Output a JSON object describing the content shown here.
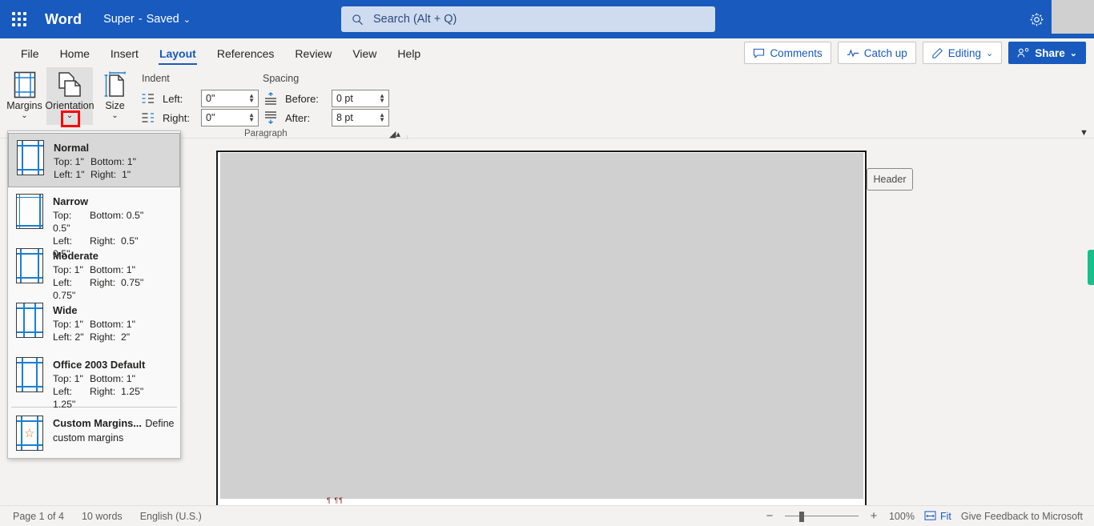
{
  "titlebar": {
    "app_grid_icon": "waffle-icon",
    "app_name": "Word",
    "doc_name": "Super",
    "doc_separator": "-",
    "save_state": "Saved",
    "doc_chevron": "⌄",
    "search_icon": "search-icon",
    "search_placeholder": "Search (Alt + Q)",
    "settings_icon": "gear-icon",
    "brand_color": "#185abd"
  },
  "tabs": [
    {
      "label": "File",
      "active": false
    },
    {
      "label": "Home",
      "active": false
    },
    {
      "label": "Insert",
      "active": false
    },
    {
      "label": "Layout",
      "active": true
    },
    {
      "label": "References",
      "active": false
    },
    {
      "label": "Review",
      "active": false
    },
    {
      "label": "View",
      "active": false
    },
    {
      "label": "Help",
      "active": false
    }
  ],
  "tabbar_buttons": [
    {
      "label": "Comments",
      "icon": "comment-icon"
    },
    {
      "label": "Catch up",
      "icon": "activity-icon"
    },
    {
      "label": "Editing",
      "icon": "pencil-icon",
      "chevron": "⌄"
    },
    {
      "label": "Share",
      "icon": "share-person-icon",
      "chevron": "⌄",
      "primary": true
    }
  ],
  "ribbon": {
    "big_buttons": [
      {
        "label": "Margins",
        "icon": "margins-icon",
        "chevron": "⌄",
        "hovered": false
      },
      {
        "label": "Orientation",
        "icon": "orientation-icon",
        "chevron": "⌄",
        "hovered": true
      },
      {
        "label": "Size",
        "icon": "size-icon",
        "chevron": "⌄",
        "hovered": false
      }
    ],
    "indent_group_title": "Indent",
    "indent_left_label": "Left:",
    "indent_left_value": "0\"",
    "indent_right_label": "Right:",
    "indent_right_value": "0\"",
    "spacing_group_title": "Spacing",
    "spacing_before_label": "Before:",
    "spacing_before_value": "0 pt",
    "spacing_after_label": "After:",
    "spacing_after_value": "8 pt",
    "group_name": "Paragraph",
    "dialog_launcher_icon": "dialog-launcher-icon",
    "collapse_icon": "chevron-down-icon"
  },
  "margins_menu": {
    "items": [
      {
        "name": "Normal",
        "top_label": "Top:",
        "top": "1\"",
        "bottom_label": "Bottom:",
        "bottom": "1\"",
        "left_label": "Left:",
        "left": "1\"",
        "right_label": "Right:",
        "right": "1\"",
        "selected": true
      },
      {
        "name": "Narrow",
        "top_label": "Top:",
        "top": "0.5\"",
        "bottom_label": "Bottom:",
        "bottom": "0.5\"",
        "left_label": "Left:",
        "left": "0.5\"",
        "right_label": "Right:",
        "right": "0.5\"",
        "selected": false
      },
      {
        "name": "Moderate",
        "top_label": "Top:",
        "top": "1\"",
        "bottom_label": "Bottom:",
        "bottom": "1\"",
        "left_label": "Left:",
        "left": "0.75\"",
        "right_label": "Right:",
        "right": "0.75\"",
        "selected": false
      },
      {
        "name": "Wide",
        "top_label": "Top:",
        "top": "1\"",
        "bottom_label": "Bottom:",
        "bottom": "1\"",
        "left_label": "Left:",
        "left": "2\"",
        "right_label": "Right:",
        "right": "2\"",
        "selected": false
      },
      {
        "name": "Office 2003 Default",
        "top_label": "Top:",
        "top": "1\"",
        "bottom_label": "Bottom:",
        "bottom": "1\"",
        "left_label": "Left:",
        "left": "1.25\"",
        "right_label": "Right:",
        "right": "1.25\"",
        "selected": false
      }
    ],
    "custom": {
      "name": "Custom Margins...",
      "description": "Define custom margins",
      "icon": "custom-margins-star-icon"
    }
  },
  "document": {
    "header_tab_label": "Header",
    "paragraph_marks": "¶ ¶¶",
    "selection_color": "#d0d0d0"
  },
  "statusbar": {
    "page_info": "Page 1 of 4",
    "word_count": "10 words",
    "language": "English (U.S.)",
    "zoom_minus": "−",
    "zoom_plus": "+",
    "zoom_level": "100%",
    "fit_label": "Fit",
    "fit_icon": "fit-width-icon",
    "feedback": "Give Feedback to Microsoft"
  }
}
